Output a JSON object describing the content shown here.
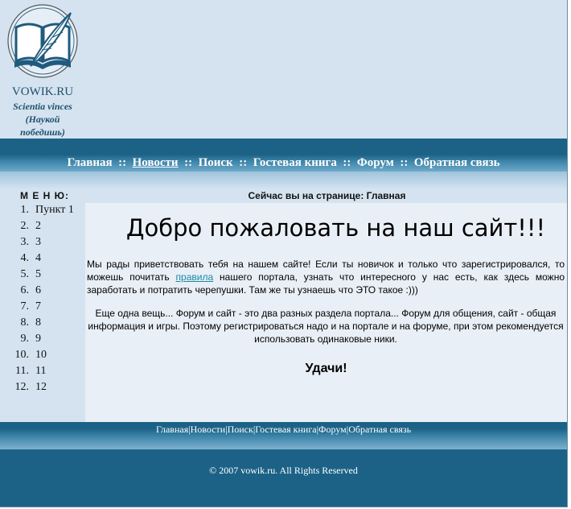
{
  "header": {
    "site_name": "VOWIK.RU",
    "motto_line1": "Scientia vinces",
    "motto_line2": "(Наукой",
    "motto_line3": "победишь)"
  },
  "nav": {
    "items": [
      {
        "label": "Главная"
      },
      {
        "label": "Новости"
      },
      {
        "label": "Поиск"
      },
      {
        "label": "Гостевая книга"
      },
      {
        "label": "Форум"
      },
      {
        "label": "Обратная связь"
      }
    ],
    "separator": "::"
  },
  "menu": {
    "title": "М Е Н Ю:",
    "items": [
      {
        "num": "1.",
        "label": "Пункт 1"
      },
      {
        "num": "2.",
        "label": "2"
      },
      {
        "num": "3.",
        "label": "3"
      },
      {
        "num": "4.",
        "label": "4"
      },
      {
        "num": "5.",
        "label": "5"
      },
      {
        "num": "6.",
        "label": "6"
      },
      {
        "num": "7.",
        "label": "7"
      },
      {
        "num": "8.",
        "label": "8"
      },
      {
        "num": "9.",
        "label": "9"
      },
      {
        "num": "10.",
        "label": "10"
      },
      {
        "num": "11.",
        "label": "11"
      },
      {
        "num": "12.",
        "label": "12"
      }
    ]
  },
  "main": {
    "breadcrumb": "Сейчас вы на странице: Главная",
    "welcome": "Добро пожаловать на наш сайт!!!",
    "p1_before": "Мы рады приветствовать тебя на нашем сайте! Если ты новичок и только что зарегистрировался, то можешь почитать ",
    "p1_link": "правила",
    "p1_after": " нашего портала, узнать что интересного у нас есть, как здесь можно заработать и потратить черепушки. Там же ты узнаешь что ЭТО такое :)))",
    "p2": "Еще одна вещь... Форум и сайт - это два разных раздела портала... Форум для общения, сайт - общая информация и игры. Поэтому регистрироваться надо и на портале и на форуме, при этом рекомендуется использовать одинаковые ники.",
    "luck": "Удачи!"
  },
  "footer": {
    "links": [
      {
        "label": "Главная"
      },
      {
        "label": "Новости"
      },
      {
        "label": "Поиск"
      },
      {
        "label": "Гостевая книга"
      },
      {
        "label": "Форум"
      },
      {
        "label": "Обратная связь"
      }
    ],
    "separator": "|",
    "copyright": "© 2007 vowik.ru. All Rights Reserved"
  },
  "colors": {
    "page_bg": "#d5e3f0",
    "dark_band": "#1c6286",
    "content_bg": "#e9eff6",
    "link": "#1a8aa0",
    "brand_text": "#1f4f6b"
  }
}
